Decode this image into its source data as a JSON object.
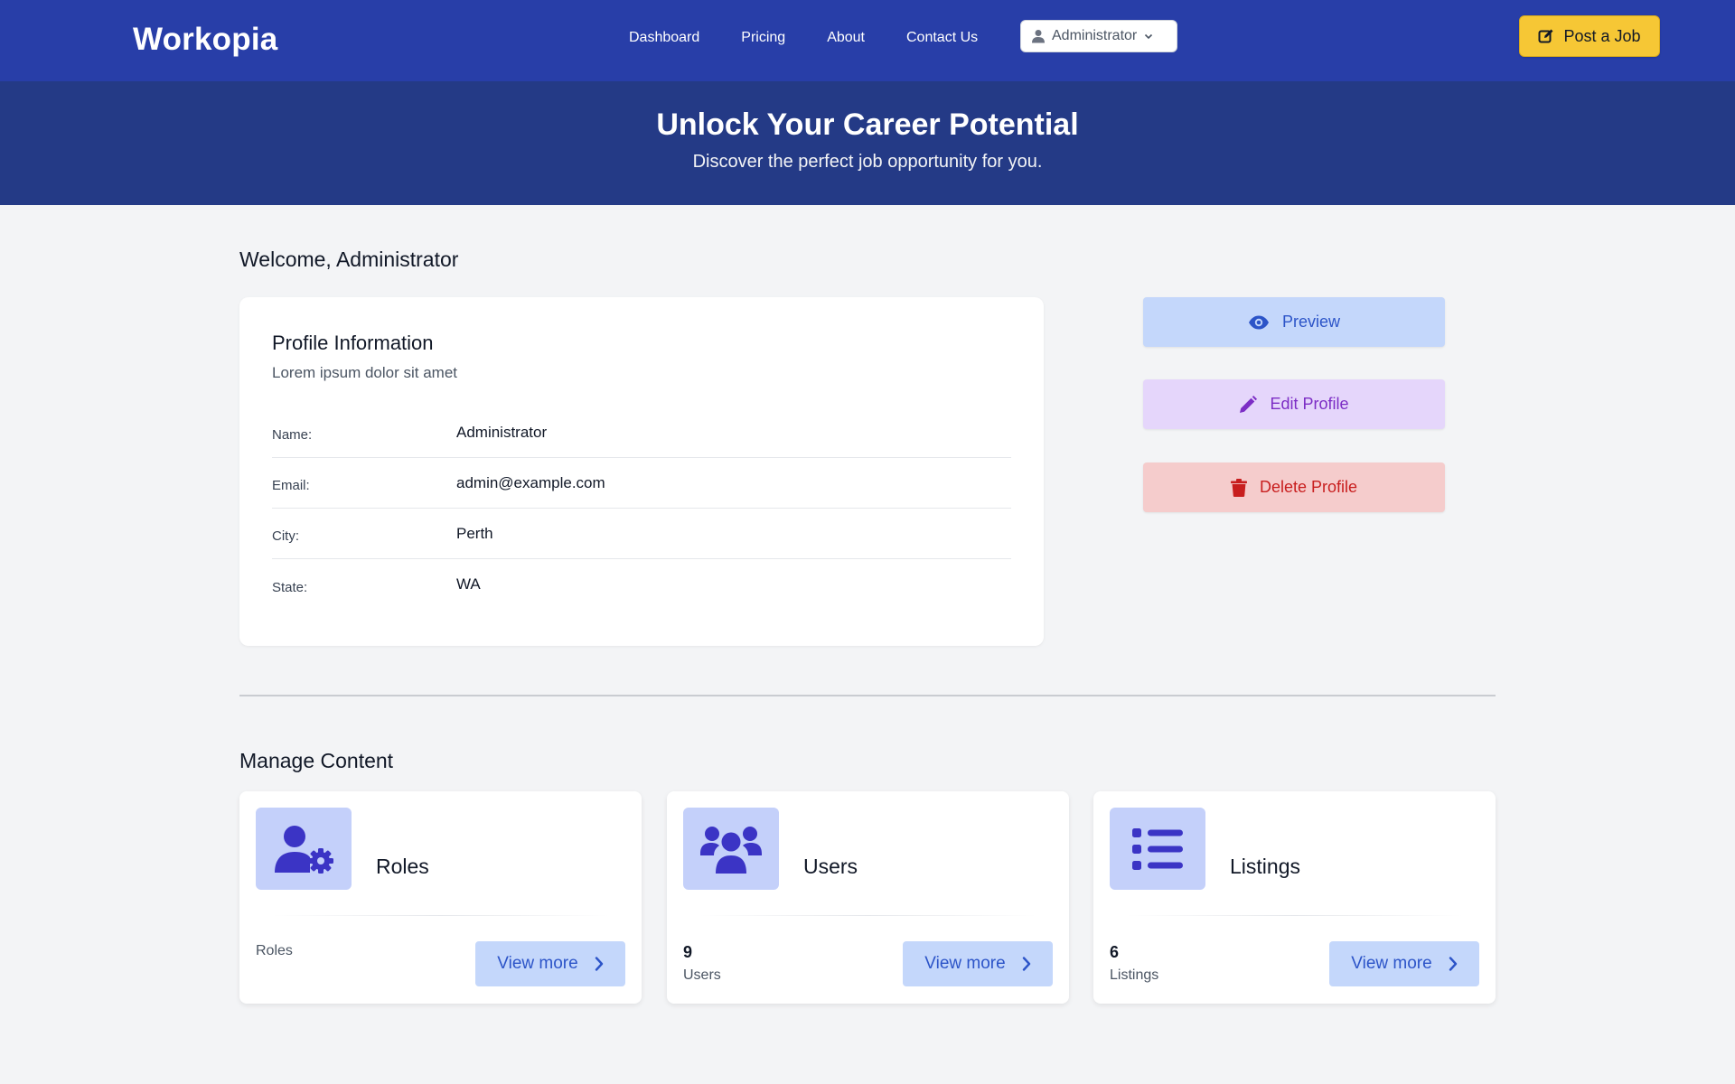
{
  "header": {
    "brand": "Workopia",
    "nav": [
      "Dashboard",
      "Pricing",
      "About",
      "Contact Us"
    ],
    "user_menu": "Administrator",
    "post_job": "Post a Job"
  },
  "hero": {
    "title": "Unlock Your Career Potential",
    "subtitle": "Discover the perfect job opportunity for you."
  },
  "welcome": "Welcome, Administrator",
  "profile": {
    "title": "Profile Information",
    "subtitle": "Lorem ipsum dolor sit amet",
    "fields": [
      {
        "label": "Name:",
        "value": "Administrator"
      },
      {
        "label": "Email:",
        "value": "admin@example.com"
      },
      {
        "label": "City:",
        "value": "Perth"
      },
      {
        "label": "State:",
        "value": "WA"
      }
    ]
  },
  "actions": {
    "preview": "Preview",
    "edit": "Edit Profile",
    "delete": "Delete Profile"
  },
  "manage": {
    "title": "Manage Content",
    "cards": [
      {
        "title": "Roles",
        "count": "",
        "caption": "Roles",
        "button": "View more",
        "icon": "user-gear-icon"
      },
      {
        "title": "Users",
        "count": "9",
        "caption": "Users",
        "button": "View more",
        "icon": "users-icon"
      },
      {
        "title": "Listings",
        "count": "6",
        "caption": "Listings",
        "button": "View more",
        "icon": "list-icon"
      }
    ]
  },
  "colors": {
    "header_bg": "#283ea8",
    "hero_bg": "#243a86",
    "accent_yellow": "#f6c735",
    "icon_indigo": "#3b34c5"
  }
}
